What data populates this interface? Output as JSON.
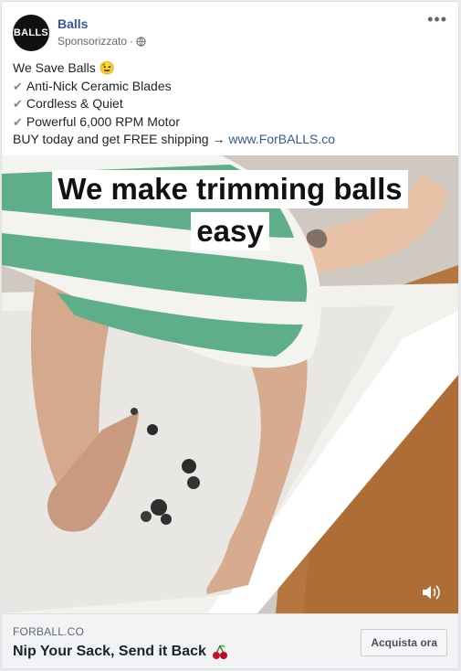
{
  "post": {
    "page_name": "Balls",
    "avatar_text": "BALLS",
    "sponsored_label": "Sponsorizzato",
    "separator": "·",
    "more_label": "•••"
  },
  "body_text": {
    "line1": "We Save Balls 😉",
    "check_mark": "✔",
    "bullets": [
      "Anti-Nick Ceramic Blades",
      "Cordless & Quiet",
      "Powerful 6,000 RPM Motor"
    ],
    "cta_prefix": "BUY today and get FREE shipping → ",
    "cta_link": "www.ForBALLS.co"
  },
  "video": {
    "caption_line1": "We make trimming balls",
    "caption_line2": "easy"
  },
  "footer": {
    "domain": "FORBALL.CO",
    "headline": "Nip Your Sack, Send it Back",
    "button_label": "Acquista ora"
  },
  "icons": {
    "globe": "globe-icon",
    "more": "more-options-icon",
    "sound": "speaker-icon",
    "cherry": "cherry-icon"
  },
  "colors": {
    "link": "#365899",
    "towel_green": "#5fae8a",
    "floor_wood": "#b5763f"
  }
}
